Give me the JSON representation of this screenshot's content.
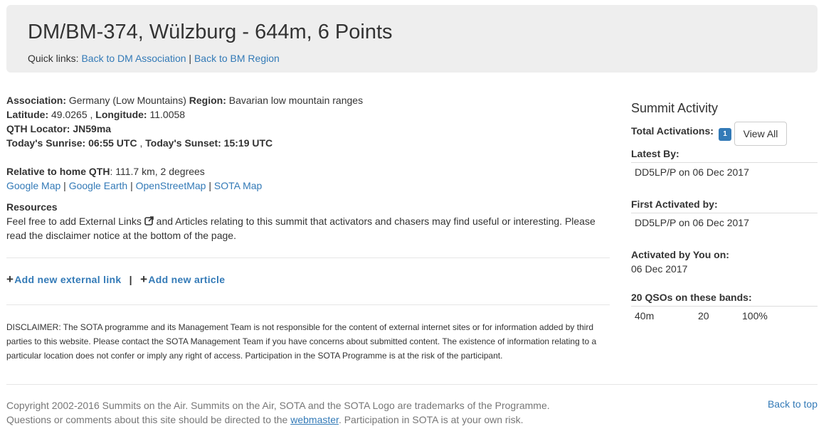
{
  "header": {
    "title": "DM/BM-374, Wülzburg - 644m, 6 Points",
    "quick_label": "Quick links:",
    "link_association": "Back to DM Association",
    "separator": "|",
    "link_region": "Back to BM Region"
  },
  "info": {
    "association_label": "Association:",
    "association": "Germany (Low Mountains)",
    "region_label": "Region:",
    "region": "Bavarian low mountain ranges",
    "latitude_label": "Latitude:",
    "latitude": "49.0265",
    "longitude_label": "Longitude:",
    "longitude": "11.0058",
    "qth_label": "QTH Locator:",
    "qth": "JN59ma",
    "sunrise": "Today's Sunrise: 06:55 UTC",
    "sunset": "Today's Sunset: 15:19 UTC",
    "relative_label": "Relative to home QTH",
    "relative": ": 111.7 km, 2 degrees",
    "maps": [
      "Google Map",
      "Google Earth",
      "OpenStreetMap",
      "SOTA Map"
    ],
    "resources_title": "Resources",
    "resources_text_1": "Feel free to add External Links",
    "resources_text_2": "and Articles relating to this summit that activators and chasers may find useful or interesting. Please read the disclaimer notice at the bottom of the page."
  },
  "actions": {
    "add_link": "Add new external link",
    "sep": "|",
    "add_article": "Add new article"
  },
  "disclaimer": "DISCLAIMER: The SOTA programme and its Management Team is not responsible for the content of external internet sites or for information added by third parties to this website. Please contact the SOTA Management Team if you have concerns about submitted content. The existence of information relating to a particular location does not confer or imply any right of access. Participation in the SOTA Programme is at the risk of the participant.",
  "activity": {
    "title": "Summit Activity",
    "total_label": "Total Activations:",
    "total": "1",
    "view_all": "View All",
    "latest_label": "Latest By:",
    "latest": "DD5LP/P on 06 Dec 2017",
    "first_label": "First Activated by:",
    "first": "DD5LP/P on 06 Dec 2017",
    "you_label": "Activated by You on:",
    "you": "06 Dec 2017",
    "qsos_label": "20 QSOs on these bands:",
    "band": "40m",
    "band_count": "20",
    "band_pct": "100%"
  },
  "footer": {
    "copyright": "Copyright 2002-2016 Summits on the Air. Summits on the Air, SOTA and the SOTA Logo are trademarks of the Programme.",
    "questions_1": "Questions or comments about this site should be directed to the",
    "webmaster": "webmaster",
    "questions_2": ". Participation in SOTA is at your own risk.",
    "back_to_top": "Back to top"
  },
  "colors": {
    "link": "#337ab7",
    "badge": "#337ab7",
    "jumbotron": "#eeeeee"
  }
}
